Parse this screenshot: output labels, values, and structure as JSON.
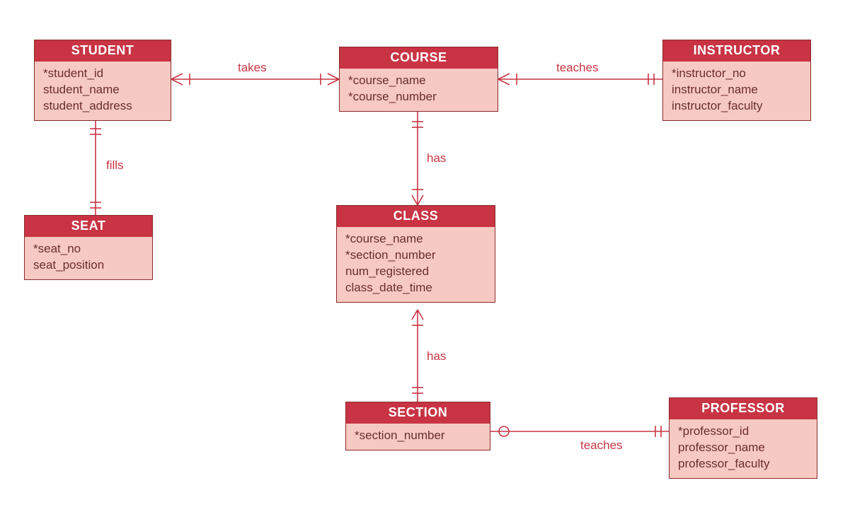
{
  "colors": {
    "header": "#c83444",
    "body": "#f6c9c2",
    "line": "#c83444",
    "text": "#6b2e2e"
  },
  "entities": {
    "student": {
      "title": "STUDENT",
      "attrs": [
        "*student_id",
        "student_name",
        "student_address"
      ]
    },
    "course": {
      "title": "COURSE",
      "attrs": [
        "*course_name",
        "*course_number"
      ]
    },
    "instructor": {
      "title": "INSTRUCTOR",
      "attrs": [
        "*instructor_no",
        "instructor_name",
        "instructor_faculty"
      ]
    },
    "seat": {
      "title": "SEAT",
      "attrs": [
        "*seat_no",
        "seat_position"
      ]
    },
    "class": {
      "title": "CLASS",
      "attrs": [
        "*course_name",
        "*section_number",
        "num_registered",
        "class_date_time"
      ]
    },
    "section": {
      "title": "SECTION",
      "attrs": [
        "*section_number"
      ]
    },
    "professor": {
      "title": "PROFESSOR",
      "attrs": [
        "*professor_id",
        "professor_name",
        "professor_faculty"
      ]
    }
  },
  "relationships": {
    "takes": {
      "label": "takes",
      "from": "student",
      "to": "course"
    },
    "teaches1": {
      "label": "teaches",
      "from": "instructor",
      "to": "course"
    },
    "fills": {
      "label": "fills",
      "from": "student",
      "to": "seat"
    },
    "has1": {
      "label": "has",
      "from": "course",
      "to": "class"
    },
    "has2": {
      "label": "has",
      "from": "class",
      "to": "section"
    },
    "teaches2": {
      "label": "teaches",
      "from": "professor",
      "to": "section"
    }
  }
}
